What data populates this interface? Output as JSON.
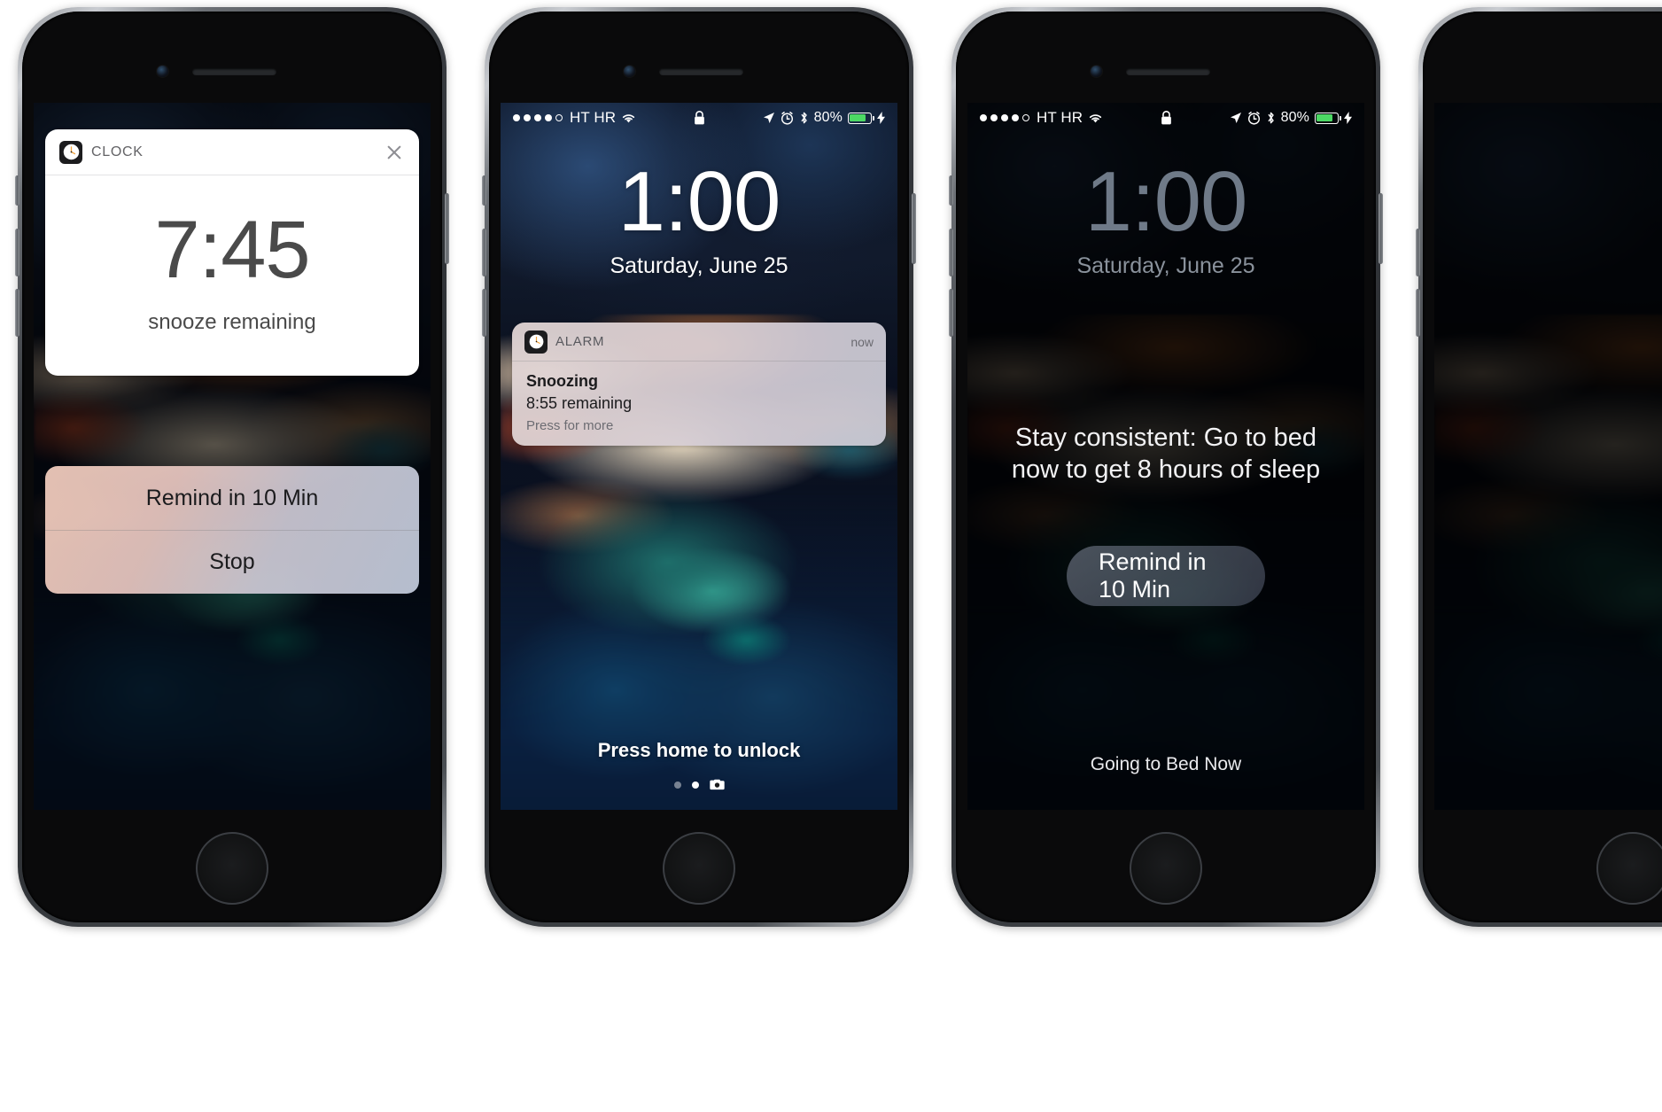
{
  "statusbar": {
    "carrier": "HT HR",
    "signal_filled": 4,
    "signal_empty": 1,
    "wifi_icon": "wifi-icon",
    "lock_icon": "lock-icon",
    "location_icon": "location-arrow-icon",
    "alarm_icon": "alarm-clock-icon",
    "bluetooth_icon": "bluetooth-icon",
    "battery_percent": "80%",
    "battery_level": 80,
    "charging_icon": "lightning-bolt-icon",
    "battery_color": "#4cd964"
  },
  "phone1": {
    "card": {
      "app_icon": "clock-app-icon",
      "app_name": "CLOCK",
      "close_icon": "close-icon",
      "time": "7:45",
      "subtitle": "snooze remaining"
    },
    "actions": [
      {
        "label": "Remind in 10 Min",
        "name": "remind-in-10-min-button"
      },
      {
        "label": "Stop",
        "name": "stop-button"
      }
    ]
  },
  "phone2": {
    "time": "1:00",
    "date": "Saturday, June 25",
    "notification": {
      "app_icon": "clock-app-icon",
      "app_name": "ALARM",
      "when": "now",
      "title": "Snoozing",
      "detail": "8:55 remaining",
      "hint": "Press for more"
    },
    "unlock_hint": "Press home to unlock",
    "camera_icon": "camera-icon",
    "pages": 2,
    "active_page": 2
  },
  "phone3": {
    "time": "1:00",
    "date": "Saturday, June 25",
    "message": "Stay consistent: Go to bed now to get 8 hours of sleep",
    "remind_label": "Remind in 10 Min",
    "bed_now_label": "Going to Bed Now"
  }
}
